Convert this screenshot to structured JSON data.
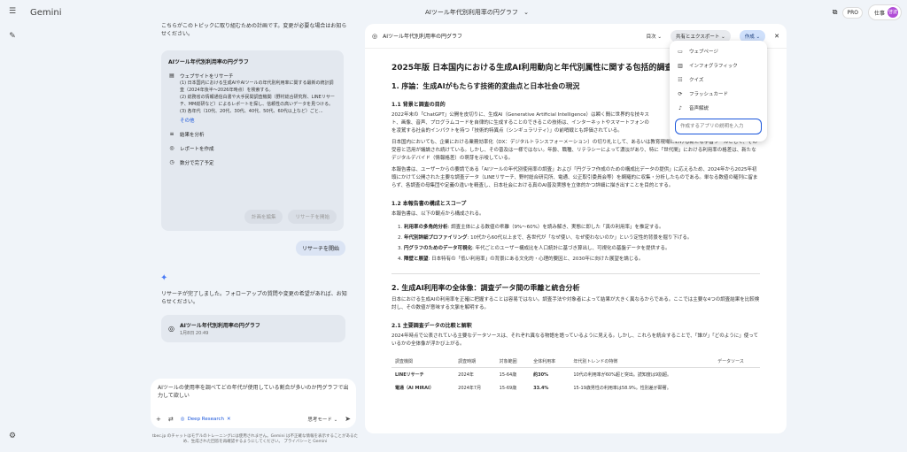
{
  "app": {
    "brand": "Gemini"
  },
  "topbar": {
    "title": "AIツール年代別利用率の円グラフ",
    "pro": "PRO",
    "account": "仕事",
    "avatar": "啓波"
  },
  "chat": {
    "intro": "こちらがこのトピックに取り組むための計画です。変更が必要な場合はお知らせください。",
    "plan": {
      "title": "AIツール年代別利用率の円グラフ",
      "research_label": "ウェブサイトをリサーチ",
      "steps": [
        "(1) 日本国内における生成AIやAIツールの年代別利用率に関する最新の統計調査（2024年後半〜2026年時点）を検索する。",
        "(2) 総務省の情報通信白書や大手民間調査機関（野村総合研究所、LINEリサーチ、MM総研など）によるレポートを探し、信頼性の高いデータを見つける。",
        "(3) 各年代（10代、20代、30代、40代、50代、60代以上など）ごと..."
      ],
      "more_label": "その他",
      "analyze_label": "結果を分析",
      "report_label": "レポートを作成",
      "eta_label": "数分で完了予定",
      "edit_button": "計画を編集",
      "start_button": "リサーチを開始"
    },
    "user_start_chip": "リサーチを開始",
    "done_text": "リサーチが完了しました。フォローアップの質問や変更の希望があれば、お知らせください。",
    "report_card": {
      "title": "AIツール年代別利用率の円グラフ",
      "time": "1月8日 20:49"
    },
    "input": {
      "text": "AIツールの使用率を調べてどの年代が使用している割合が多いのか円グラフで出力して欲しい",
      "deep_research_label": "Deep Research",
      "mode_label": "思考モード"
    },
    "disclaimer": "tbec.jp のチャットはモデルのトレーニングには使用されません。Gemini は不正確な情報を表示することがあるため、生成された回答を再確認するようにしてください。 プライバシーと Gemini"
  },
  "doc": {
    "title": "AIツール年代別利用率の円グラフ",
    "toc_label": "目次",
    "share_label": "共有とエクスポート",
    "create_label": "作成",
    "h1": "2025年版 日本国内における生成AI利用動向と年代別属性に関する包括的調査報",
    "s1": "1. 序論：生成AIがもたらす技術的変曲点と日本社会の現況",
    "s1_1": "1.1 背景と調査の目的",
    "p1": "2022年末の「ChatGPT」公開を皮切りに、生成AI（Generative Artificial Intelligence）は瞬く間に世界的な技キスト、画像、音声、プログラムコードを自律的に生成することのできるこの技術は、インターネットやスマートフォンのを凌駕する社会的インパクトを持つ「技術的特異点（シンギュラリティ）」の前哨戦とも評価されている。",
    "p2": "日本国内においても、企業における業務効率化（DX：デジタルトランスフォーメーション）の切り札として、あるいは教育現場における新たな学習ツールとして、その受容と活用が議論され続けている。しかし、その普及は一様ではない。年齢、職種、リテラシーによって濃淡があり、特に「世代間」における利用率の格差は、新たなデジタルデバイド（情報格差）の萌芽を示唆している。",
    "p3": "本報告書は、ユーザーからの要請である「AIツールの年代別使用率の調査」および「円グラフ作成のための構成比データの提供」に応えるため、2024年から2025年初頭にかけて公開された主要な調査データ（LINEリサーチ、野村総合研究所、電通、公正取引委員会等）を網羅的に収集・分析したものである。単なる数値の羅列に留まらず、各調査の母集団や定義の違いを精査し、日本社会における真のAI普及実態を立体的かつ詳細に描き出すことを目的とする。",
    "s1_2": "1.2 本報告書の構成とスコープ",
    "p4": "本報告書は、以下の観点から構成される。",
    "list": [
      {
        "b": "利用率の多角的分析",
        "t": ": 調査主体による数値の乖離（9%〜60%）を読み解き、実態に即した「真の利用率」を推定する。"
      },
      {
        "b": "年代別詳細プロファイリング",
        "t": ": 10代から60代以上まで、各世代が「なぜ使い、なぜ使わないのか」という定性的背景を掘り下げる。"
      },
      {
        "b": "円グラフのためのデータ可視化",
        "t": ": 年代ごとのユーザー構成比を人口統計に基づき算出し、可視化の基盤データを提供する。"
      },
      {
        "b": "障壁と展望",
        "t": ": 日本特有の「低い利用率」の背景にある文化的・心理的要因と、2030年に向けた展望を論じる。"
      }
    ],
    "s2": "2. 生成AI利用率の全体像：調査データ間の乖離と統合分析",
    "p5": "日本における生成AIの利用率を正確に把握することは容易ではない。調査手法や対象者によって結果が大きく異なるからである。ここでは主要な4つの調査結果を比較検討し、その数値が意味する文脈を解明する。",
    "s2_1": "2.1 主要調査データの比較と解釈",
    "p6": "2024年時点で公表されている主要なデータソースは、それぞれ異なる物語を語っているように見える。しかし、これらを統合することで、「誰が」「どのように」使っているかの全体像が浮かび上がる。",
    "table": {
      "headers": [
        "調査機関",
        "調査時期",
        "対象範囲",
        "全体利用率",
        "年代別トレンドの特徴",
        "データソース"
      ],
      "rows": [
        [
          "LINEリサーチ",
          "2024年",
          "15-64歳",
          "約30%",
          "10代の利用率が60%超と突出。読知度は9割超。",
          ""
        ],
        [
          "電通（AI MIRAI）",
          "2024年7月",
          "15-69歳",
          "33.4%",
          "15-19歳男性の利用率は58.9%。性別差が顕著。",
          ""
        ]
      ]
    }
  },
  "create_menu": {
    "items": [
      {
        "label": "ウェブページ",
        "icon": "webpage-icon"
      },
      {
        "label": "インフォグラフィック",
        "icon": "infographic-icon"
      },
      {
        "label": "クイズ",
        "icon": "quiz-icon"
      },
      {
        "label": "フラッシュカード",
        "icon": "flashcard-icon"
      },
      {
        "label": "音声解説",
        "icon": "audio-icon"
      }
    ],
    "placeholder": "作成するアプリの説明を入力"
  }
}
